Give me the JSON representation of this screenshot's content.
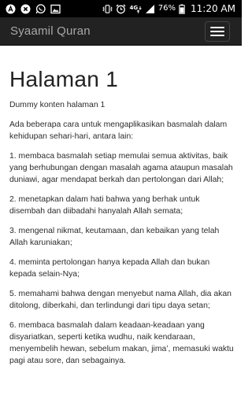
{
  "status_bar": {
    "left_icons": [
      "a-circle-icon",
      "x-circle-icon",
      "whatsapp-icon",
      "image-icon"
    ],
    "right_icons": [
      "vibrate-icon",
      "alarm-icon",
      "4g-icon",
      "signal-icon"
    ],
    "network": "4G",
    "battery_percent": "76%",
    "time": "11:20 AM"
  },
  "app_bar": {
    "brand": "Syaamil Quran",
    "menu_icon": "hamburger-icon"
  },
  "content": {
    "title": "Halaman 1",
    "dummy": "Dummy konten halaman 1",
    "intro": "Ada beberapa cara untuk mengaplikasikan basmalah dalam kehidupan sehari-hari, antara lain:",
    "items": [
      "1. membaca basmalah setiap memulai semua aktivitas, baik yang berhubungan dengan masalah agama ataupun masalah duniawi, agar mendapat berkah dan pertolongan dari Allah;",
      "2. menetapkan dalam hati bahwa yang berhak untuk disembah dan diibadahi hanyalah Allah semata;",
      "3. mengenal nikmat, keutamaan, dan kebaikan yang telah Allah karuniakan;",
      "4. meminta pertolongan hanya kepada Allah dan bukan kepada selain-Nya;",
      "5. memahami bahwa dengan menyebut nama Allah, dia akan ditolong, diberkahi, dan terlindungi dari tipu daya setan;",
      "6. membaca basmalah dalam keadaan-keadaan yang disyariatkan, seperti ketika wudhu, naik kendaraan, menyembelih hewan, sebelum makan, jima’, memasuki waktu pagi atau sore, dan sebagainya."
    ]
  }
}
